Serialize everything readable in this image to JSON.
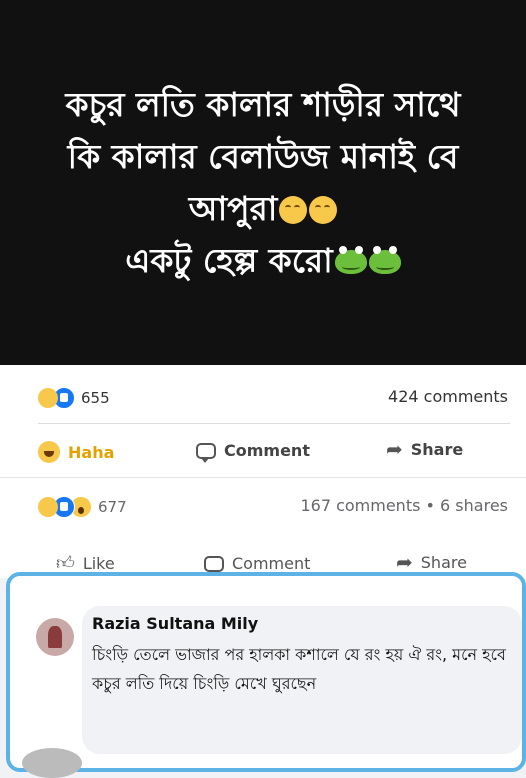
{
  "post": {
    "lines": [
      "কচুর লতি কালার শাড়ীর সাথে",
      "কি কালার বেলাউজ মানাই বে",
      "আপুরা",
      "একটু হেল্প করো"
    ],
    "emoji": {
      "line3": "smiling-face-icon",
      "line4": "frog-face-icon"
    }
  },
  "card1": {
    "reaction_count": "655",
    "comments": "424 comments",
    "haha_label": "Haha",
    "comment_label": "Comment",
    "share_label": "Share"
  },
  "card2": {
    "reaction_count": "677",
    "meta": "167 comments • 6 shares",
    "like_label": "Like",
    "comment_label": "Comment",
    "share_label": "Share"
  },
  "comment": {
    "author": "Razia Sultana Mily",
    "text": "চিংড়ি তেলে ভাজার পর হালকা কশালে যে রং হয় ঐ রং,  মনে হবে কচুর লতি দিয়ে চিংড়ি মেখে ঘুরছেন"
  },
  "colors": {
    "highlight_border": "#5eb3e6",
    "haha": "#e5a100",
    "like_blue": "#1877f2"
  }
}
